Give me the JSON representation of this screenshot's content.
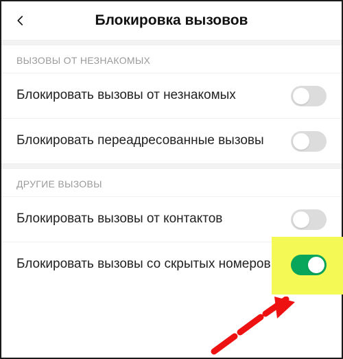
{
  "header": {
    "title": "Блокировка вызовов"
  },
  "sections": {
    "unknown": {
      "header": "ВЫЗОВЫ ОТ НЕЗНАКОМЫХ",
      "items": [
        {
          "label": "Блокировать вызовы от незнакомых",
          "on": false
        },
        {
          "label": "Блокировать переадресованные вызовы",
          "on": false
        }
      ]
    },
    "other": {
      "header": "ДРУГИЕ ВЫЗОВЫ",
      "items": [
        {
          "label": "Блокировать вызовы от контактов",
          "on": false
        },
        {
          "label": "Блокировать вызовы со скрытых номеров",
          "on": true
        }
      ]
    }
  },
  "annotation": {
    "highlight_color": "#f4f955",
    "arrow_color": "#e11",
    "toggle_on_color": "#07a65a"
  }
}
